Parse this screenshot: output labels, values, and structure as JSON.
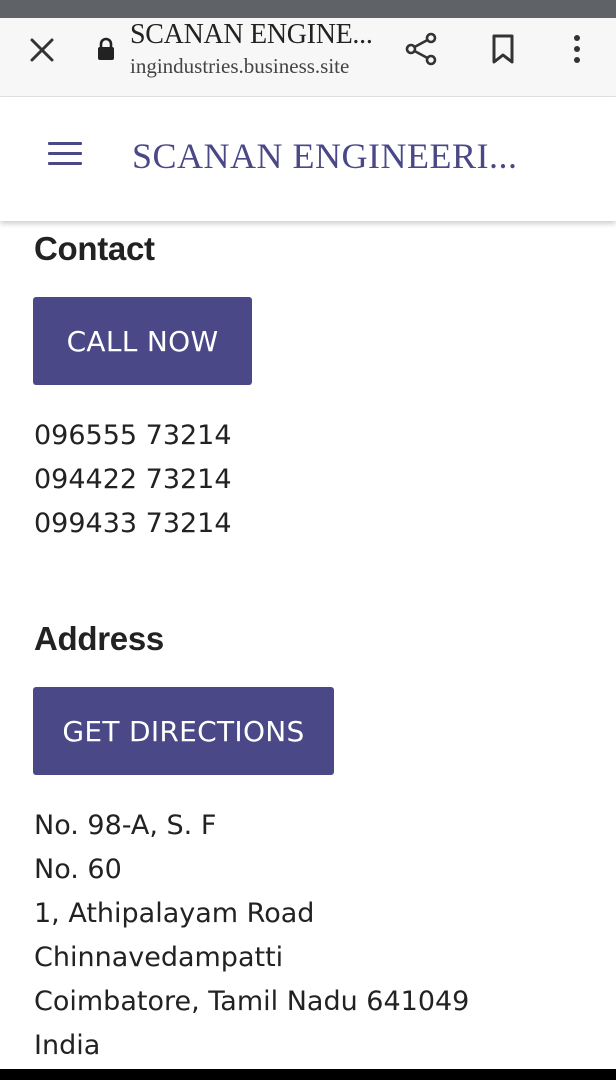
{
  "browser": {
    "page_title": "SCANAN ENGINE...",
    "url": "ingindustries.business.site",
    "icons": {
      "close": "close-icon",
      "lock": "lock-icon",
      "share": "share-icon",
      "bookmark": "bookmark-icon",
      "more": "more-vert-icon"
    }
  },
  "header": {
    "menu_icon": "hamburger-menu-icon",
    "site_title": "SCANAN ENGINEERI..."
  },
  "contact": {
    "heading": "Contact",
    "call_button_label": "CALL NOW",
    "phones": [
      "096555 73214",
      "094422 73214",
      "099433 73214"
    ]
  },
  "address": {
    "heading": "Address",
    "directions_button_label": "GET DIRECTIONS",
    "lines": [
      "No. 98-A, S. F",
      "No. 60",
      "1, Athipalayam Road",
      "Chinnavedampatti",
      "Coimbatore, Tamil Nadu 641049",
      "India"
    ]
  },
  "colors": {
    "brand": "#4a4886",
    "text": "#222222",
    "browser_bar": "#f7f7f7"
  }
}
